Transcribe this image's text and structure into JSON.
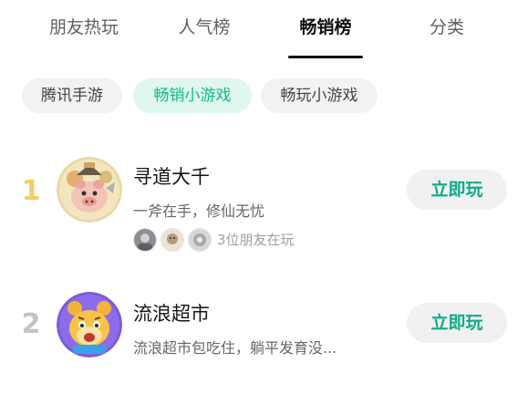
{
  "tabs": [
    {
      "label": "朋友热玩"
    },
    {
      "label": "人气榜"
    },
    {
      "label": "畅销榜",
      "active": true
    },
    {
      "label": "分类"
    }
  ],
  "chips": [
    {
      "label": "腾讯手游"
    },
    {
      "label": "畅销小游戏",
      "active": true
    },
    {
      "label": "畅玩小游戏"
    }
  ],
  "games": [
    {
      "rank": "1",
      "name": "寻道大千",
      "description": "一斧在手，修仙无忧",
      "friends_text": "3位朋友在玩",
      "button": "立即玩",
      "rank_color": "#f0cf6c"
    },
    {
      "rank": "2",
      "name": "流浪超市",
      "description": "流浪超市包吃住，躺平发育没...",
      "button": "立即玩",
      "rank_color": "#c4c4c4"
    }
  ],
  "colors": {
    "accent": "#13b88a",
    "chip_active_bg": "#dff7ef"
  }
}
